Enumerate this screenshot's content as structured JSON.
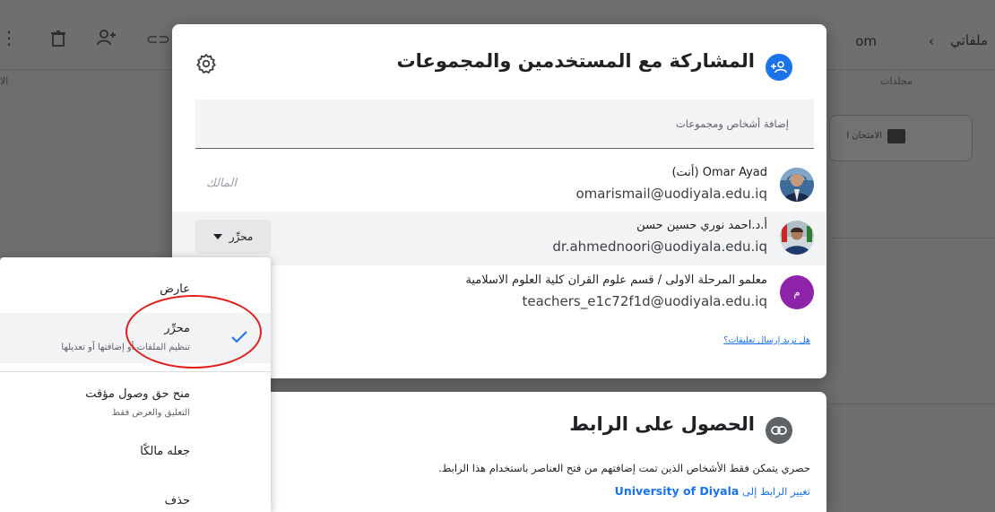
{
  "background": {
    "breadcrumb_root": "ملفاتي",
    "breadcrumb_fragment": "om",
    "header_label": "مجلدات",
    "left_fragment": "الا",
    "folder_fragment": "الامتحان ا"
  },
  "share_dialog": {
    "title": "المشاركة مع المستخدمين والمجموعات",
    "add_placeholder": "إضافة أشخاص ومجموعات",
    "people": [
      {
        "name": "Omar Ayad (أنت)",
        "email": "omarismail@uodiyala.edu.iq",
        "role": "المالك"
      },
      {
        "name": "أ.د.احمد نوري حسين حسن",
        "email": "dr.ahmednoori@uodiyala.edu.iq",
        "role": "محرِّر"
      },
      {
        "name": "معلمو المرحلة الاولى / قسم علوم القران كلية العلوم الاسلامية",
        "email": "teachers_e1c72f1d@uodiyala.edu.iq",
        "initial": "م"
      }
    ],
    "feedback_link": "هل تريد إرسال تعليقات؟"
  },
  "link_dialog": {
    "title": "الحصول على الرابط",
    "description": "حصري يتمكن فقط الأشخاص الذين تمت إضافتهم من فتح العناصر باستخدام هذا الرابط.",
    "change_prefix": "تغيير الرابط إلى",
    "change_org": "University of Diyala"
  },
  "role_menu": {
    "items": [
      {
        "label": "عارض",
        "sub": ""
      },
      {
        "label": "محرِّر",
        "sub": "تنظيم الملفات أو إضافتها أو تعديلها",
        "selected": true
      },
      {
        "label": "منح حق وصول مؤقت",
        "sub": "التعليق والعرض فقط"
      },
      {
        "label": "جعله مالكًا",
        "sub": ""
      },
      {
        "label": "حذف",
        "sub": ""
      }
    ]
  },
  "colors": {
    "accent_blue": "#1a73e8",
    "avatar_purple": "#8e24aa",
    "link_icon_gray": "#5f6368",
    "annotation_red": "#e0201b"
  },
  "icons": {
    "share_icon": "person-add-icon",
    "settings": "gear-icon",
    "link": "link-icon",
    "dropdown": "caret-down-icon",
    "check": "check-icon"
  }
}
